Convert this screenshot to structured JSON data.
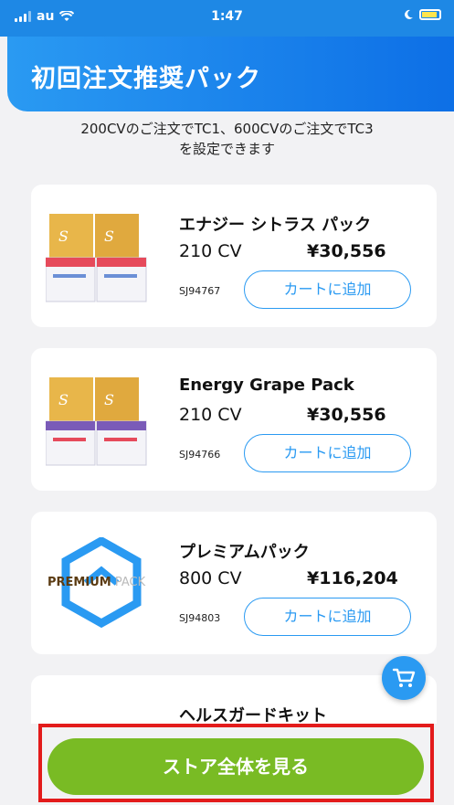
{
  "status_bar": {
    "carrier": "au",
    "time": "1:47"
  },
  "header": {
    "title": "初回注文推奨パック"
  },
  "subtitle": {
    "line1": "200CVのご注文でTC1、600CVのご注文でTC3",
    "line2": "を設定できます"
  },
  "products": [
    {
      "name": "エナジー シトラス パック",
      "cv": "210 CV",
      "price": "¥30,556",
      "sku": "SJ94767",
      "button": "カートに追加"
    },
    {
      "name": "Energy Grape Pack",
      "cv": "210 CV",
      "price": "¥30,556",
      "sku": "SJ94766",
      "button": "カートに追加"
    },
    {
      "name": "プレミアムパック",
      "cv": "800 CV",
      "price": "¥116,204",
      "sku": "SJ94803",
      "button": "カートに追加",
      "logo_text": "PREMIUM PACK"
    },
    {
      "name": "ヘルスガードキット"
    }
  ],
  "footer": {
    "store_button": "ストア全体を見る"
  },
  "colors": {
    "primary": "#2a9af2",
    "accent_green": "#79bb24",
    "highlight_red": "#e31b1b"
  }
}
